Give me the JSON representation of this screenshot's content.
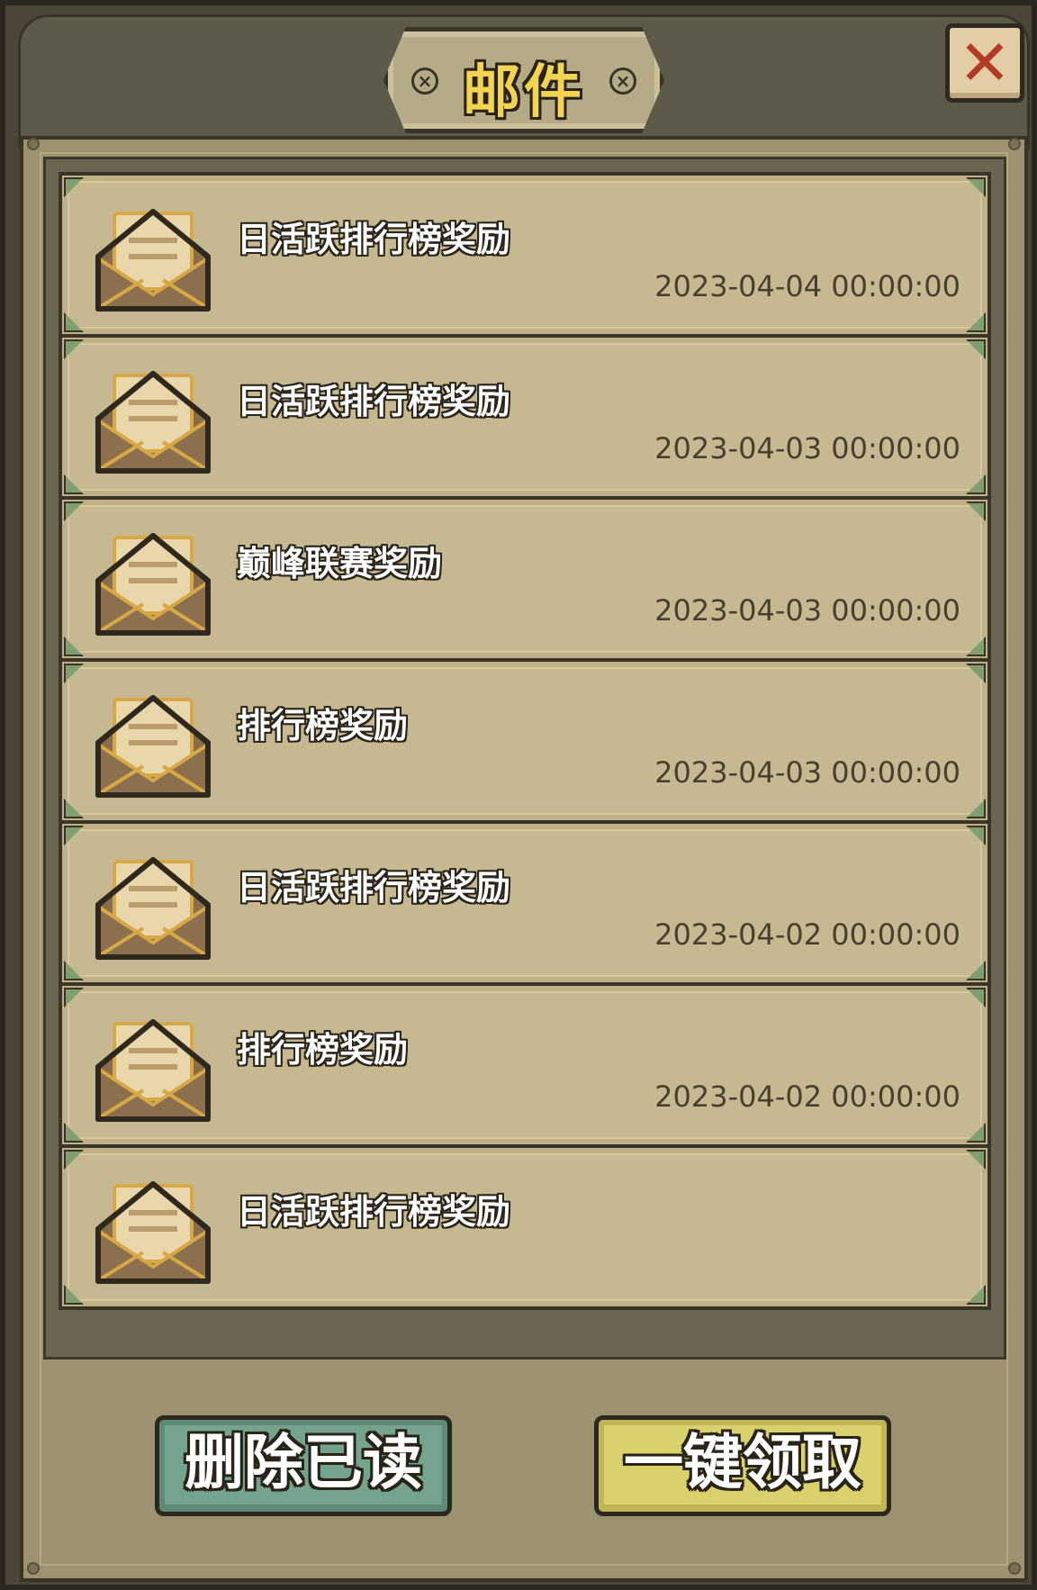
{
  "window": {
    "title": "邮件",
    "close_label": "✕"
  },
  "mails": [
    {
      "title": "日活跃排行榜奖励",
      "date": "2023-04-04 00:00:00"
    },
    {
      "title": "日活跃排行榜奖励",
      "date": "2023-04-03 00:00:00"
    },
    {
      "title": "巅峰联赛奖励",
      "date": "2023-04-03 00:00:00"
    },
    {
      "title": "排行榜奖励",
      "date": "2023-04-03 00:00:00"
    },
    {
      "title": "日活跃排行榜奖励",
      "date": "2023-04-02 00:00:00"
    },
    {
      "title": "排行榜奖励",
      "date": "2023-04-02 00:00:00"
    },
    {
      "title": "日活跃排行榜奖励",
      "date": ""
    }
  ],
  "buttons": {
    "delete_read": "删除已读",
    "claim_all": "一键领取"
  },
  "icons": {
    "mail": "open-envelope-icon",
    "close": "close-icon"
  },
  "colors": {
    "title": "#f2d452",
    "close_x": "#b33a26",
    "delete_button": "#74a48e",
    "claim_button": "#d9d26c"
  }
}
